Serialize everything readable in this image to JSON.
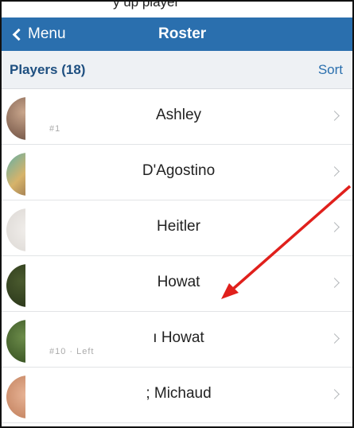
{
  "caption_fragment": "y up    player",
  "navbar": {
    "back_label": "Menu",
    "title": "Roster"
  },
  "section": {
    "title": "Players (18)",
    "sort_label": "Sort"
  },
  "players": [
    {
      "name": "Ashley",
      "sub": "#1"
    },
    {
      "name": "D'Agostino",
      "sub": ""
    },
    {
      "name": "Heitler",
      "sub": ""
    },
    {
      "name": "Howat",
      "sub": ""
    },
    {
      "name": "ı Howat",
      "sub": "#10 · Left"
    },
    {
      "name": "; Michaud",
      "sub": ""
    }
  ],
  "annotation": {
    "arrow_color": "#e0201c"
  }
}
